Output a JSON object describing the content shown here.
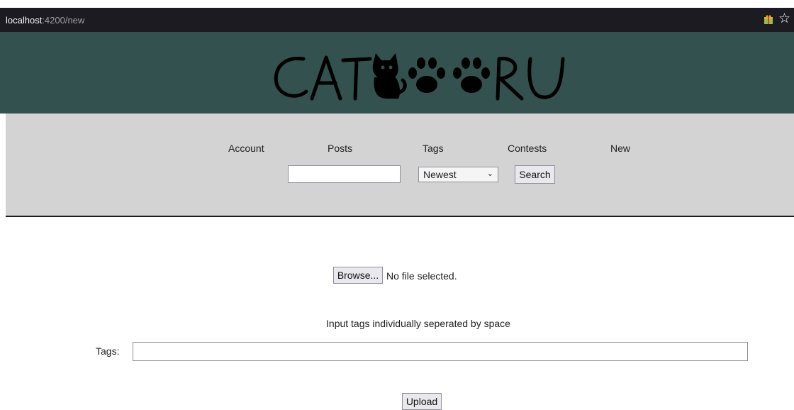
{
  "browser": {
    "url_host": "localhost",
    "url_rest": ":4200/new"
  },
  "header": {
    "logo_text": "CAT🐾🐾RU"
  },
  "nav": {
    "items": [
      "Account",
      "Posts",
      "Tags",
      "Contests",
      "New"
    ]
  },
  "search": {
    "value": "",
    "sort_selected": "Newest",
    "button_label": "Search"
  },
  "upload_form": {
    "browse_label": "Browse...",
    "file_status": "No file selected.",
    "hint": "Input tags individually seperated by space",
    "tags_label": "Tags:",
    "tags_value": "",
    "upload_label": "Upload"
  },
  "colors": {
    "browser_bar": "#1c1b22",
    "banner": "#33524f",
    "nav_panel": "#d3d3d3"
  }
}
